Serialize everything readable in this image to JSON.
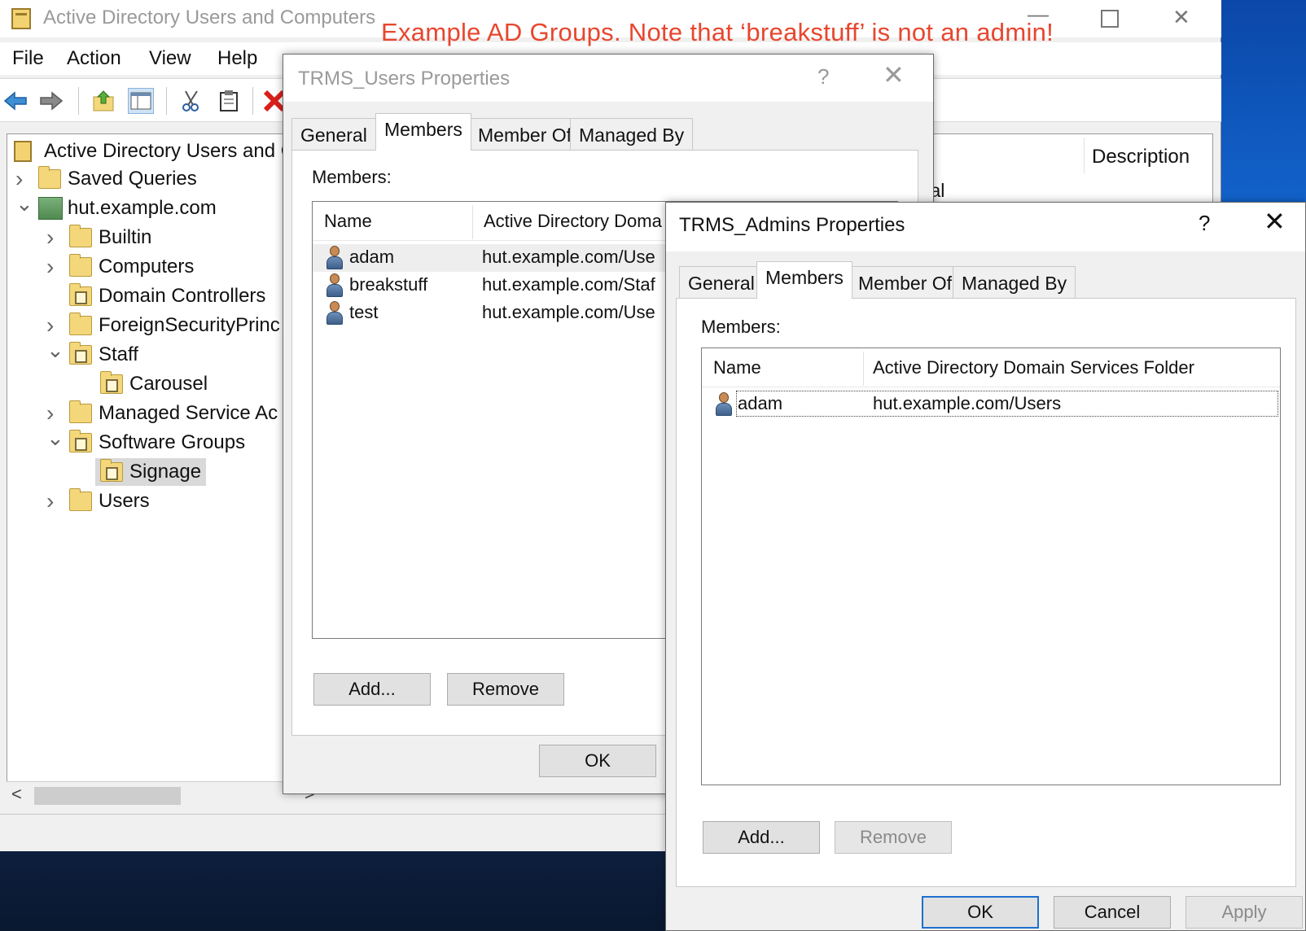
{
  "annotation": "Example AD Groups. Note that ‘breakstuff’ is not an admin!",
  "window": {
    "title": "Active Directory Users and Computers"
  },
  "menu": [
    "File",
    "Action",
    "View",
    "Help"
  ],
  "toolbar_icons": [
    "back-arrow-icon",
    "forward-arrow-icon",
    "up-folder-icon",
    "show-tree-icon",
    "cut-icon",
    "clipboard-icon",
    "delete-icon"
  ],
  "tree": {
    "root": "Active Directory Users and C",
    "items": [
      {
        "label": "Saved Queries",
        "expander": ">",
        "icon": "folder-icon"
      },
      {
        "label": "hut.example.com",
        "expander": "v",
        "icon": "domain-icon"
      },
      {
        "label": "Builtin",
        "expander": ">",
        "icon": "folder-icon"
      },
      {
        "label": "Computers",
        "expander": ">",
        "icon": "folder-icon"
      },
      {
        "label": "Domain Controllers",
        "expander": "",
        "icon": "ou-icon"
      },
      {
        "label": "ForeignSecurityPrinc",
        "expander": ">",
        "icon": "folder-icon"
      },
      {
        "label": "Staff",
        "expander": "v",
        "icon": "ou-icon"
      },
      {
        "label": "Carousel",
        "expander": "",
        "icon": "ou-icon"
      },
      {
        "label": "Managed Service Ac",
        "expander": ">",
        "icon": "folder-icon"
      },
      {
        "label": "Software Groups",
        "expander": "v",
        "icon": "ou-icon"
      },
      {
        "label": "Signage",
        "expander": "",
        "icon": "ou-icon",
        "selected": true
      },
      {
        "label": "Users",
        "expander": ">",
        "icon": "folder-icon"
      }
    ]
  },
  "right_panel": {
    "column": "Description",
    "partial_text": "sal"
  },
  "users_dialog": {
    "title": "TRMS_Users Properties",
    "help": "?",
    "tabs": [
      "General",
      "Members",
      "Member Of",
      "Managed By"
    ],
    "active_tab": "Members",
    "members_label": "Members:",
    "columns": [
      "Name",
      "Active Directory Doma"
    ],
    "rows": [
      {
        "name": "adam",
        "folder": "hut.example.com/Use"
      },
      {
        "name": "breakstuff",
        "folder": "hut.example.com/Staf"
      },
      {
        "name": "test",
        "folder": "hut.example.com/Use"
      }
    ],
    "add_label": "Add...",
    "remove_label": "Remove",
    "ok_label": "OK"
  },
  "admins_dialog": {
    "title": "TRMS_Admins Properties",
    "help": "?",
    "tabs": [
      "General",
      "Members",
      "Member Of",
      "Managed By"
    ],
    "active_tab": "Members",
    "members_label": "Members:",
    "columns": [
      "Name",
      "Active Directory Domain Services Folder"
    ],
    "rows": [
      {
        "name": "adam",
        "folder": "hut.example.com/Users"
      }
    ],
    "add_label": "Add...",
    "remove_label": "Remove",
    "ok_label": "OK",
    "cancel_label": "Cancel",
    "apply_label": "Apply"
  }
}
